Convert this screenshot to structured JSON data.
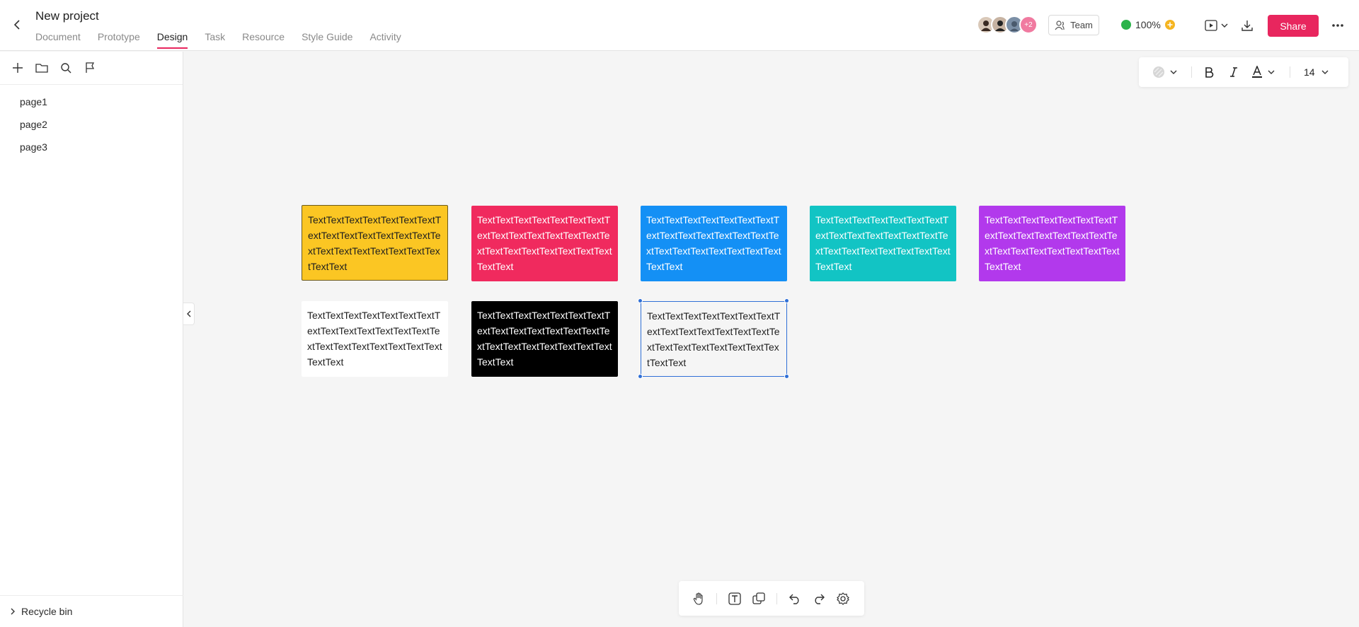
{
  "header": {
    "project_title": "New project",
    "tabs": [
      {
        "label": "Document"
      },
      {
        "label": "Prototype"
      },
      {
        "label": "Design",
        "active": true
      },
      {
        "label": "Task"
      },
      {
        "label": "Resource"
      },
      {
        "label": "Style Guide"
      },
      {
        "label": "Activity"
      }
    ],
    "avatars": {
      "extra_count": "+2"
    },
    "team_label": "Team",
    "zoom": "100%",
    "share_label": "Share",
    "accent_color": "#e8265e"
  },
  "sidebar": {
    "tools": [
      "plus-icon",
      "folder-icon",
      "search-icon",
      "flag-icon"
    ],
    "pages": [
      {
        "label": "page1"
      },
      {
        "label": "page2"
      },
      {
        "label": "page3"
      }
    ],
    "recycle_label": "Recycle bin"
  },
  "text_toolbar": {
    "font_size": "14",
    "items": [
      "fill-color-icon",
      "bold-icon",
      "italic-icon",
      "text-color-icon",
      "font-size-select"
    ]
  },
  "canvas": {
    "notes": [
      {
        "text": "TextTextTextTextTextTextTextTextTextTextTextTextTextTextTextTextTextTextTextTextTextTextTextText",
        "bg": "#fbc623",
        "color": "#1f1f1f",
        "style": "yellow"
      },
      {
        "text": "TextTextTextTextTextTextTextTextTextTextTextTextTextTextTextTextTextTextTextTextTextTextTextText",
        "bg": "#f02a5e",
        "color": "#ffffff"
      },
      {
        "text": "TextTextTextTextTextTextTextTextTextTextTextTextTextTextTextTextTextTextTextTextTextTextTextText",
        "bg": "#1490f5",
        "color": "#ffffff"
      },
      {
        "text": "TextTextTextTextTextTextTextTextTextTextTextTextTextTextTextTextTextTextTextTextTextTextTextText",
        "bg": "#12c4c4",
        "color": "#ffffff"
      },
      {
        "text": "TextTextTextTextTextTextTextTextTextTextTextTextTextTextTextTextTextTextTextTextTextTextTextText",
        "bg": "#b239ec",
        "color": "#ffffff"
      },
      {
        "text": "TextTextTextTextTextTextTextTextTextTextTextTextTextTextTextTextTextTextTextTextTextTextTextText",
        "bg": "#ffffff",
        "color": "#1f1f1f"
      },
      {
        "text": "TextTextTextTextTextTextTextTextTextTextTextTextTextTextTextTextTextTextTextTextTextTextTextText",
        "bg": "#000000",
        "color": "#ffffff"
      },
      {
        "text": "TextTextTextTextTextTextTextTextTextTextTextTextTextTextTextTextTextTextTextTextTextTextTextText",
        "bg": "#f5f5f5",
        "color": "#1f1f1f",
        "style": "selected"
      }
    ]
  },
  "bottom_toolbar": {
    "items": [
      "hand-icon",
      "text-tool-icon",
      "shape-tool-icon",
      "undo-icon",
      "redo-icon",
      "settings-icon"
    ]
  }
}
